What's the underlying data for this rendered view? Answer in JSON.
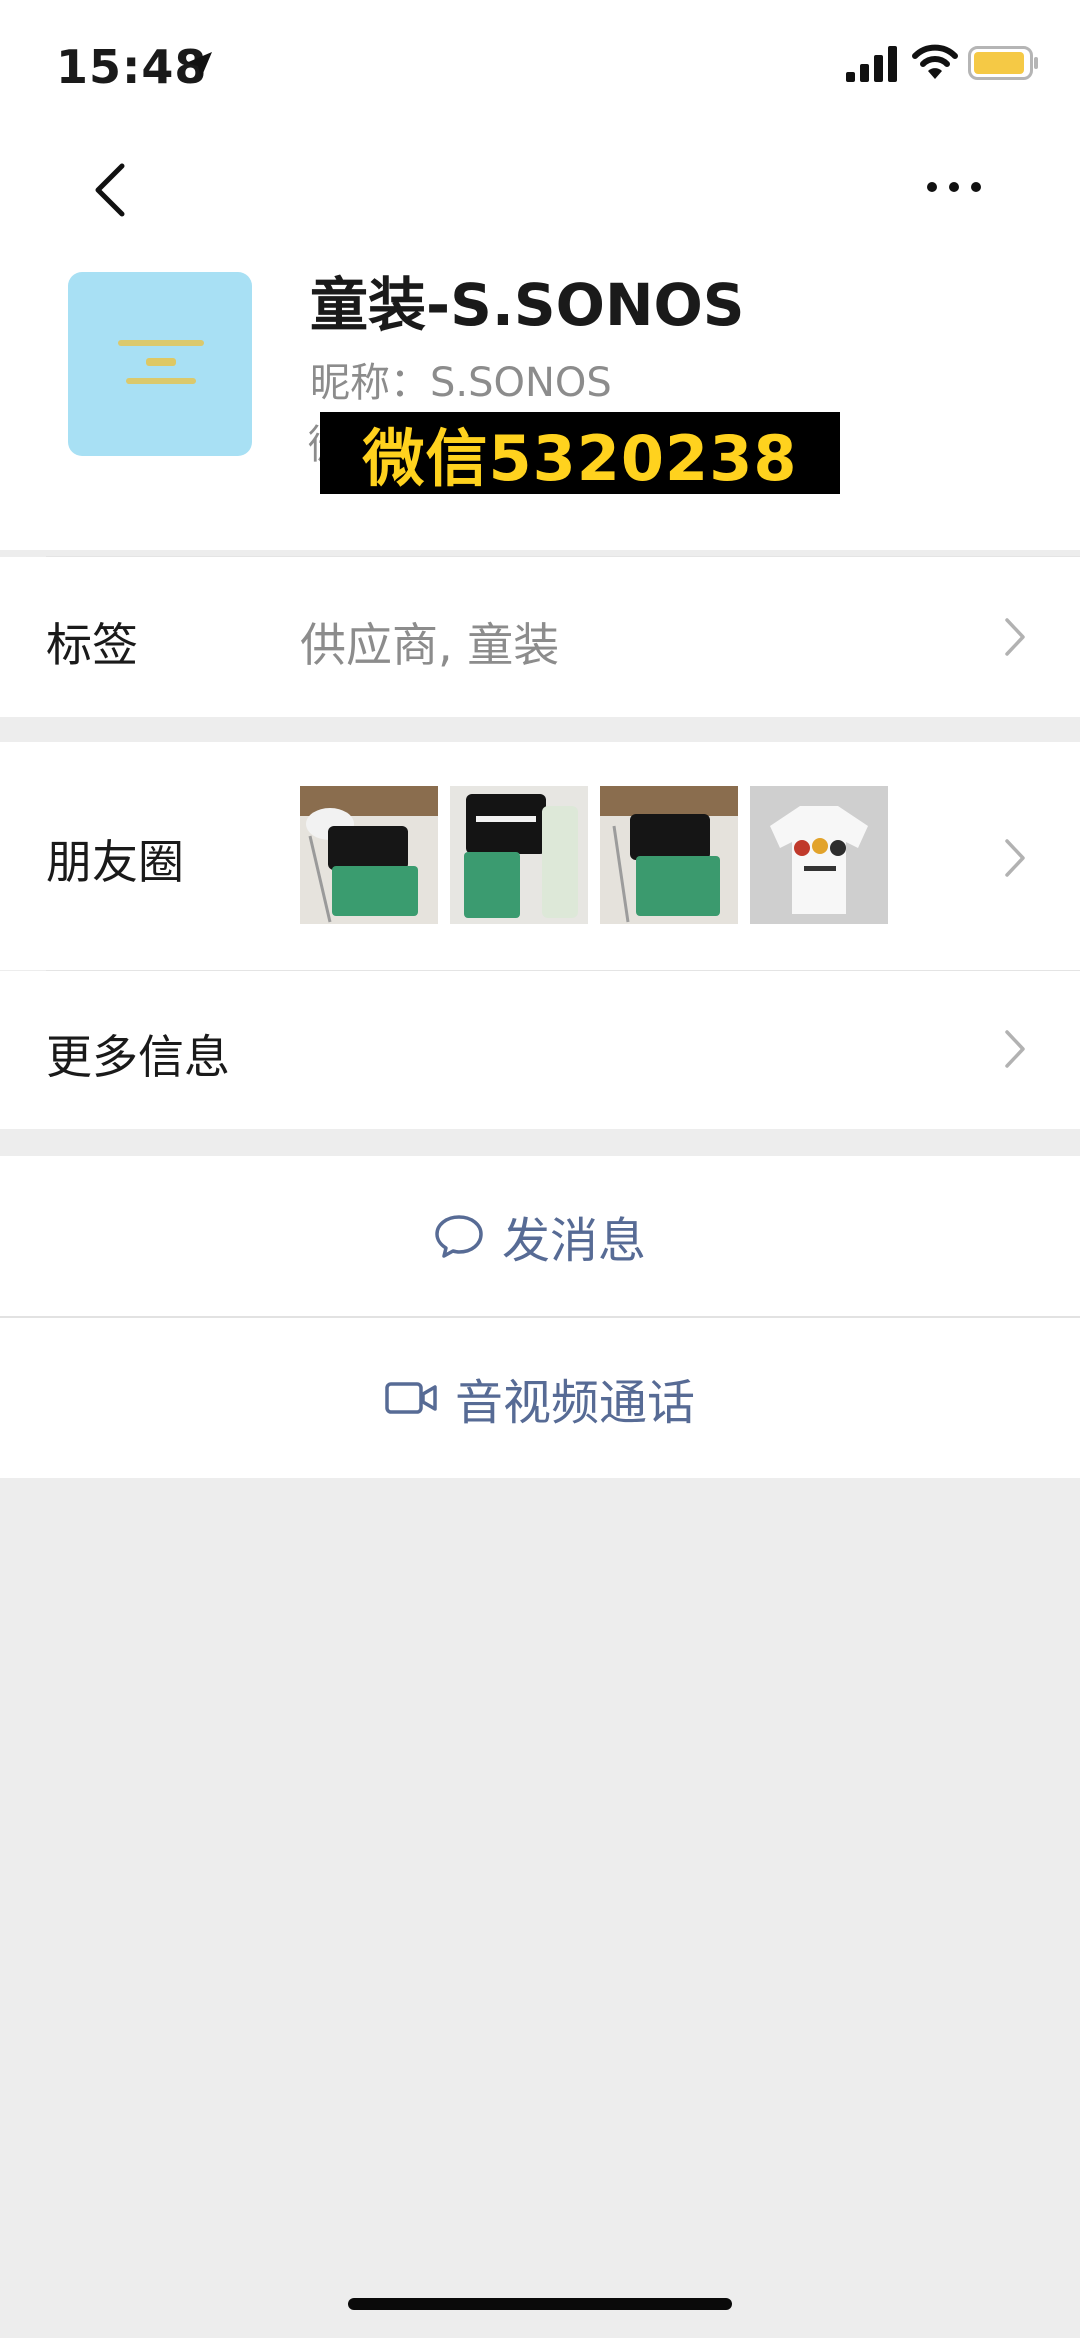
{
  "status_bar": {
    "time": "15:48"
  },
  "profile": {
    "name": "童装-S.SONOS",
    "nickname": "昵称：S.SONOS",
    "id_prefix": "微",
    "overlay_banner": "微信5320238"
  },
  "rows": {
    "tags": {
      "label": "标签",
      "value": "供应商, 童装"
    },
    "moments": {
      "label": "朋友圈"
    },
    "more_info": {
      "label": "更多信息"
    }
  },
  "actions": {
    "message": "发消息",
    "call": "音视频通话"
  },
  "colors": {
    "link_blue": "#576b95",
    "banner_yellow": "#ffd21e",
    "avatar_bg": "#a8e0f4",
    "battery": "#f5c945"
  },
  "icons": [
    "location-arrow-icon",
    "cellular-signal-icon",
    "wifi-icon",
    "battery-icon",
    "back-arrow-icon",
    "more-dots-icon",
    "chevron-right-icon",
    "chat-bubble-icon",
    "video-camera-icon"
  ]
}
